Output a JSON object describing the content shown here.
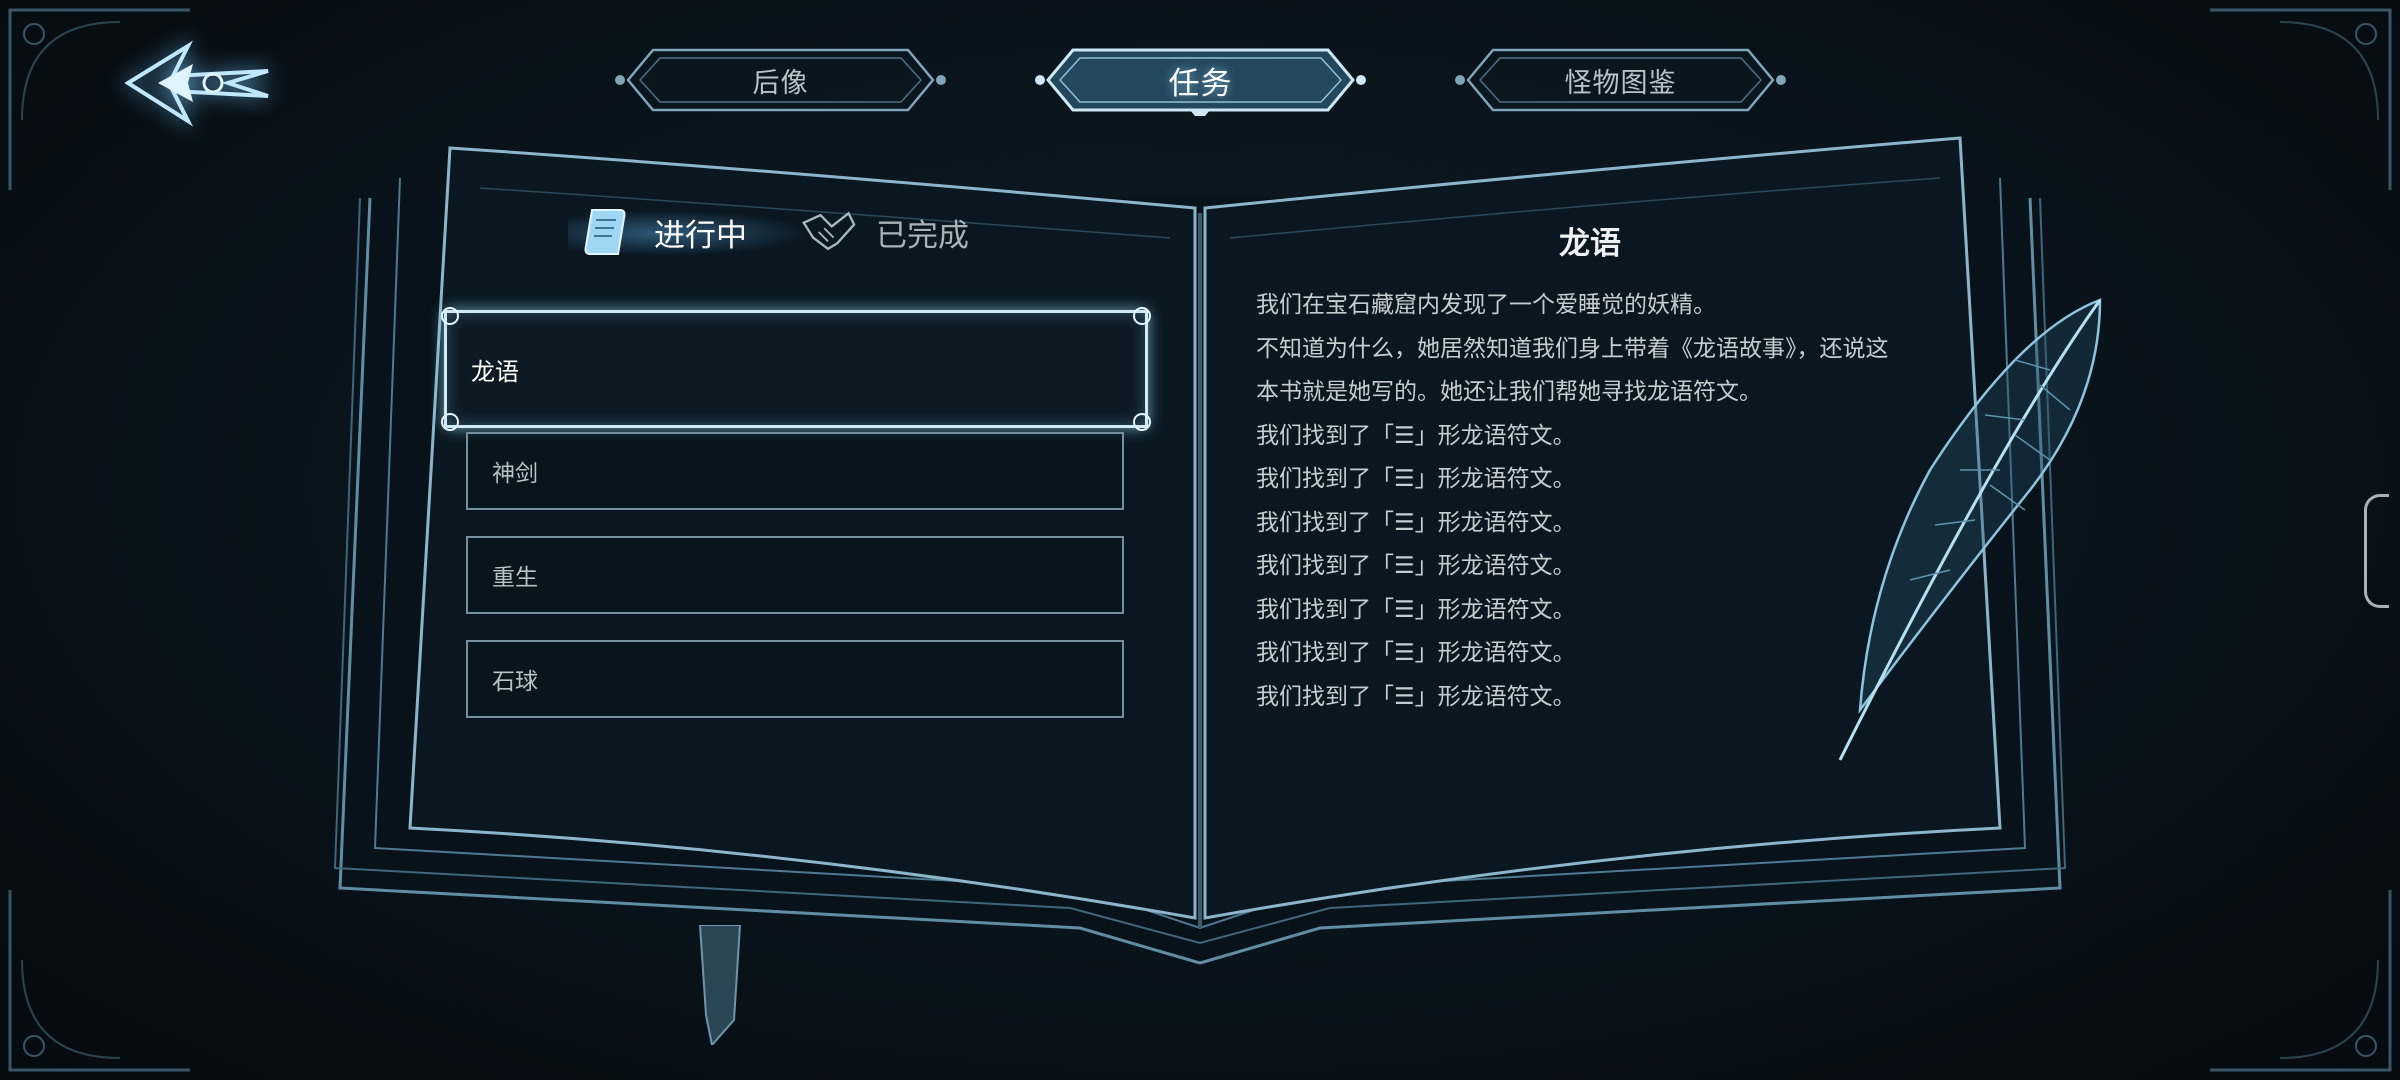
{
  "tabs": [
    {
      "label": "后像",
      "active": false
    },
    {
      "label": "任务",
      "active": true
    },
    {
      "label": "怪物图鉴",
      "active": false
    }
  ],
  "status_tabs": {
    "in_progress": "进行中",
    "completed": "已完成"
  },
  "quests": [
    {
      "label": "龙语",
      "selected": true
    },
    {
      "label": "神剑",
      "selected": false
    },
    {
      "label": "重生",
      "selected": false
    },
    {
      "label": "石球",
      "selected": false
    }
  ],
  "detail": {
    "title": "龙语",
    "lines": [
      "我们在宝石藏窟内发现了一个爱睡觉的妖精。",
      "不知道为什么，她居然知道我们身上带着《龙语故事》，还说这",
      "本书就是她写的。她还让我们帮她寻找龙语符文。",
      "我们找到了「☰」形龙语符文。",
      "我们找到了「☰」形龙语符文。",
      "我们找到了「☰」形龙语符文。",
      "我们找到了「☰」形龙语符文。",
      "我们找到了「☰」形龙语符文。",
      "我们找到了「☰」形龙语符文。",
      "我们找到了「☰」形龙语符文。"
    ]
  },
  "icons": {
    "back": "back-arrow-icon",
    "in_progress": "scroll-icon",
    "completed": "handshake-icon",
    "quill": "quill-icon"
  },
  "colors": {
    "accent": "#7fd0ff",
    "border": "#75909c",
    "background": "#09131b"
  }
}
